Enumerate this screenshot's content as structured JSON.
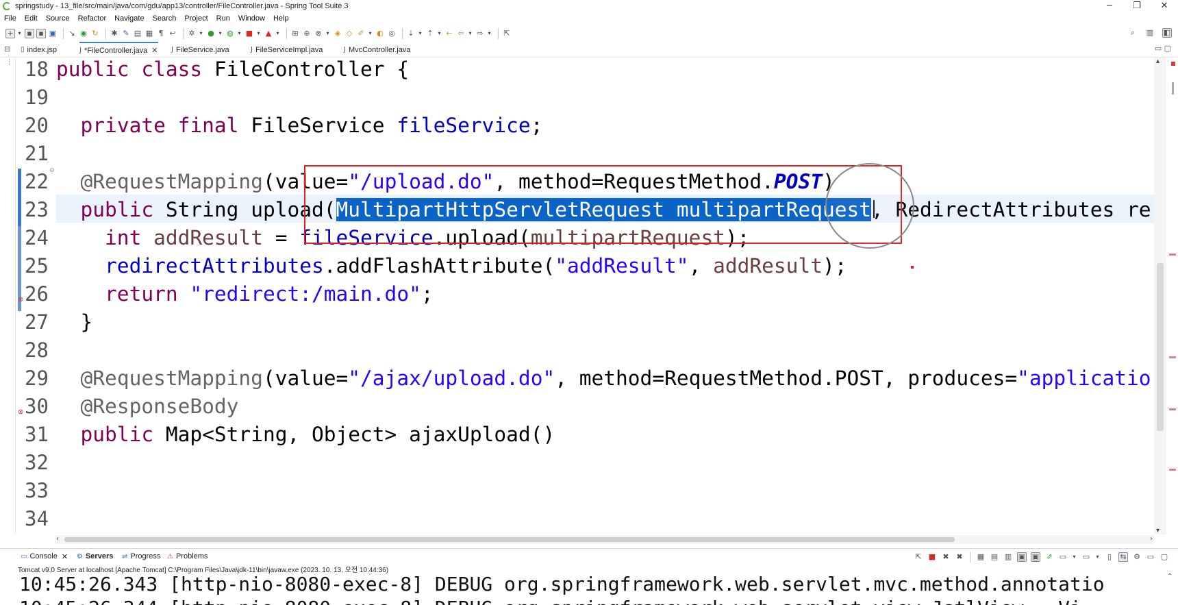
{
  "window": {
    "title": "springstudy - 13_file/src/main/java/com/gdu/app13/controller/FileController.java - Spring Tool Suite 3",
    "controls": [
      "─",
      "❐",
      "✕"
    ]
  },
  "menu": [
    "File",
    "Edit",
    "Source",
    "Refactor",
    "Navigate",
    "Search",
    "Project",
    "Run",
    "Window",
    "Help"
  ],
  "tabs": [
    {
      "label": "index.jsp",
      "active": false
    },
    {
      "label": "*FileController.java",
      "active": true,
      "close": "✕"
    },
    {
      "label": "FileService.java",
      "active": false
    },
    {
      "label": "FileServiceImpl.java",
      "active": false
    },
    {
      "label": "MvcController.java",
      "active": false
    }
  ],
  "editor": {
    "lines": [
      {
        "n": "18",
        "text": "public class FileController {"
      },
      {
        "n": "19",
        "text": ""
      },
      {
        "n": "20",
        "text": "  private final FileService fileService;"
      },
      {
        "n": "21",
        "text": ""
      },
      {
        "n": "22",
        "text": "  @RequestMapping(value=\"/upload.do\", method=RequestMethod.POST)"
      },
      {
        "n": "23",
        "text": "  public String upload(MultipartHttpServletRequest multipartRequest, RedirectAttributes re"
      },
      {
        "n": "24",
        "text": "    int addResult = fileService.upload(multipartRequest);"
      },
      {
        "n": "25",
        "text": "    redirectAttributes.addFlashAttribute(\"addResult\", addResult);"
      },
      {
        "n": "26",
        "text": "    return \"redirect:/main.do\";"
      },
      {
        "n": "27",
        "text": "  }"
      },
      {
        "n": "28",
        "text": ""
      },
      {
        "n": "29",
        "text": "  @RequestMapping(value=\"/ajax/upload.do\", method=RequestMethod.POST, produces=\"applicatio"
      },
      {
        "n": "30",
        "text": "  @ResponseBody"
      },
      {
        "n": "31",
        "text": "  public Map<String, Object> ajaxUpload()"
      },
      {
        "n": "32",
        "text": ""
      },
      {
        "n": "33",
        "text": ""
      },
      {
        "n": "34",
        "text": ""
      }
    ],
    "selected_text": "MultipartHttpServletRequest multipartRequest"
  },
  "panel": {
    "tabs": [
      {
        "label": "Console",
        "close": "✕"
      },
      {
        "label": "Servers"
      },
      {
        "label": "Progress"
      },
      {
        "label": "Problems"
      }
    ],
    "server_label": "Tomcat v9.0 Server at localhost [Apache Tomcat] C:\\Program Files\\Java\\jdk-11\\bin\\javaw.exe  (2023. 10. 13. 오전 10:44:36)",
    "console_lines": [
      "10:45:26.343 [http-nio-8080-exec-8] DEBUG org.springframework.web.servlet.mvc.method.annotatio",
      "10:45:26.344 [http-nio-8080-exec-8] DEBUG org.springframework.web.servlet.view.JstlView - Vi"
    ]
  },
  "colors": {
    "keyword": "#7f0055",
    "string": "#2a00ff",
    "field": "#0000c0",
    "selection": "#0a64c8",
    "highlight_box": "#e02020"
  }
}
